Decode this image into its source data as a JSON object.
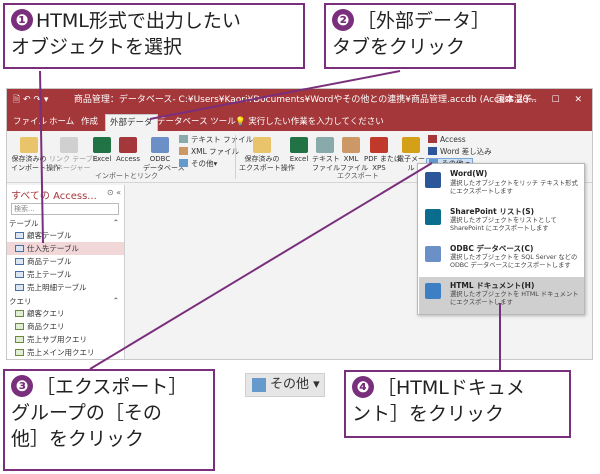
{
  "callouts": {
    "c1": {
      "num": "❶",
      "line1": "HTML形式で出力したい",
      "line2": "オブジェクトを選択"
    },
    "c2": {
      "num": "❷",
      "line1": "［外部データ］",
      "line2": "タブをクリック"
    },
    "c3": {
      "num": "❸",
      "line1": "［エクスポート］",
      "line2": "グループの［その",
      "line3": "他］をクリック"
    },
    "c4": {
      "num": "❹",
      "line1": "［HTMLドキュメ",
      "line2": "ント］をクリック"
    }
  },
  "titlebar": {
    "title": "商品管理：データベース- C:¥Users¥Kaori¥Documents¥Wordやその他との連携¥商品管理.accdb (Access 20...",
    "user": "国本温子",
    "controls": "?  —  ☐  ✕"
  },
  "tabs": [
    "ファイル",
    "ホーム",
    "作成",
    "外部データ",
    "データベース ツール",
    "実行したい作業を入力してください"
  ],
  "ribbon": {
    "import_group": {
      "label": "インポートとリンク",
      "buttons": [
        "保存済みの\nインポート操作",
        "リンク テーブル\nマネージャー",
        "Excel",
        "Access",
        "ODBC\nデータベース"
      ],
      "small": [
        "テキスト ファイル",
        "XML ファイル",
        "その他▾"
      ]
    },
    "export_group": {
      "label": "エクスポート",
      "buttons": [
        "保存済みの\nエクスポート操作",
        "Excel",
        "テキスト\nファイル",
        "XML\nファイル",
        "PDF または\nXPS",
        "電子メール"
      ],
      "small": [
        "Access",
        "Word 差し込み",
        "その他 ▾"
      ]
    }
  },
  "nav": {
    "title": "すべての Access...",
    "controls": "⊙ «",
    "search_placeholder": "検索...",
    "sections": [
      {
        "name": "テーブル",
        "items": [
          "顧客テーブル",
          "仕入先テーブル",
          "商品テーブル",
          "売上テーブル",
          "売上明細テーブル"
        ]
      },
      {
        "name": "クエリ",
        "items": [
          "顧客クエリ",
          "商品クエリ",
          "売上サブ用クエリ",
          "売上メイン用クエリ"
        ]
      }
    ],
    "selected": "仕入先テーブル"
  },
  "menu": [
    {
      "title": "Word(W)",
      "desc": "選択したオブジェクトをリッチ テキスト形式にエクスポートします"
    },
    {
      "title": "SharePoint リスト(S)",
      "desc": "選択したオブジェクトをリストとして SharePoint にエクスポートします"
    },
    {
      "title": "ODBC データベース(C)",
      "desc": "選択したオブジェクトを SQL Server などの ODBC データベースにエクスポートします"
    },
    {
      "title": "HTML ドキュメント(H)",
      "desc": "選択したオブジェクトを HTML ドキュメントにエクスポートします"
    }
  ],
  "zoom_button": {
    "label": "その他 ▾"
  },
  "colors": {
    "accent": "#7a2f7c",
    "access_red": "#a4373a"
  }
}
